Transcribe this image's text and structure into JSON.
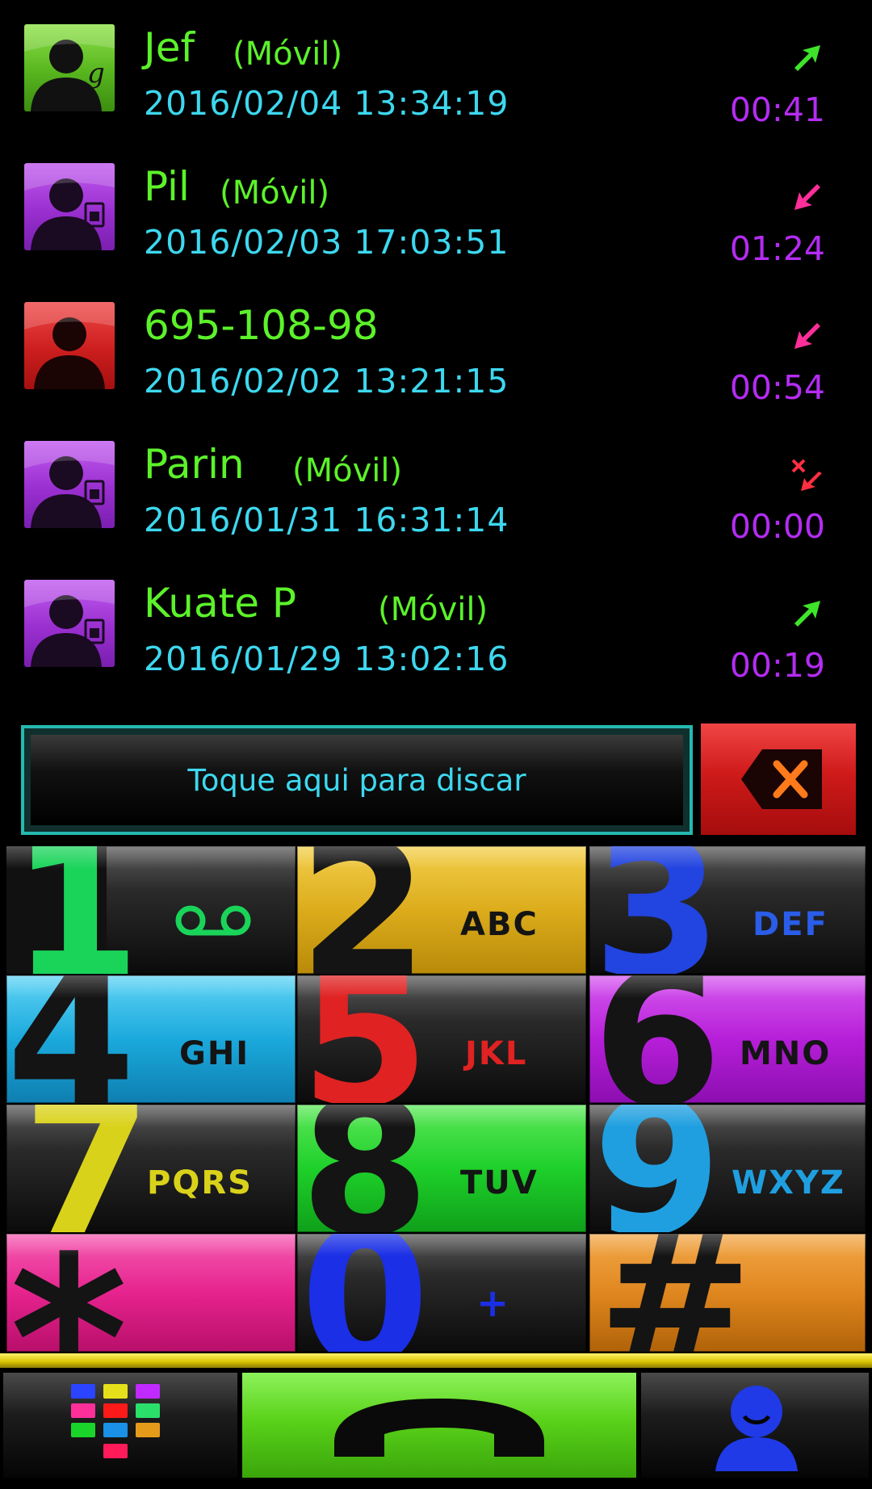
{
  "calls": [
    {
      "name": "Jef",
      "type": "(Móvil)",
      "date": "2016/02/04 13:34:19",
      "duration": "00:41",
      "direction": "outgoing",
      "avatar": "google-contact"
    },
    {
      "name": "Pil",
      "type": "(Móvil)",
      "date": "2016/02/03 17:03:51",
      "duration": "01:24",
      "direction": "incoming",
      "avatar": "sim-contact"
    },
    {
      "name": "695-108-98",
      "type": "",
      "date": "2016/02/02 13:21:15",
      "duration": "00:54",
      "direction": "incoming",
      "avatar": "unknown-contact"
    },
    {
      "name": "Parin",
      "type": "(Móvil)",
      "date": "2016/01/31 16:31:14",
      "duration": "00:00",
      "direction": "missed",
      "avatar": "sim-contact"
    },
    {
      "name": "Kuate P",
      "type": "(Móvil)",
      "date": "2016/01/29 13:02:16",
      "duration": "00:19",
      "direction": "outgoing",
      "avatar": "sim-contact"
    }
  ],
  "dial": {
    "placeholder": "Toque aqui para discar",
    "backspace_icon": "backspace-x-icon"
  },
  "keypad": [
    {
      "digit": "1",
      "letters": "",
      "icon": "voicemail-icon",
      "color": "#1ad45a"
    },
    {
      "digit": "2",
      "letters": "ABC",
      "color": "#e2b52a"
    },
    {
      "digit": "3",
      "letters": "DEF",
      "color": "#2244e0"
    },
    {
      "digit": "4",
      "letters": "GHI",
      "color": "#1ba9dc"
    },
    {
      "digit": "5",
      "letters": "JKL",
      "color": "#e02222"
    },
    {
      "digit": "6",
      "letters": "MNO",
      "color": "#b61fd8"
    },
    {
      "digit": "7",
      "letters": "PQRS",
      "color": "#d9d21a"
    },
    {
      "digit": "8",
      "letters": "TUV",
      "color": "#1ed02a"
    },
    {
      "digit": "9",
      "letters": "WXYZ",
      "color": "#1f9fe0"
    },
    {
      "digit": "*",
      "letters": "",
      "color": "#e6238e"
    },
    {
      "digit": "0",
      "letters": "+",
      "color": "#1a2fe6"
    },
    {
      "digit": "#",
      "letters": "",
      "color": "#e0871f"
    }
  ],
  "bottom_bar": {
    "apps_icon": "app-grid-icon",
    "call_icon": "phone-handset-icon",
    "contacts_icon": "contact-person-icon"
  },
  "colors": {
    "name": "#5cf22a",
    "date": "#3dd8ef",
    "duration": "#b42cf2",
    "outgoing_arrow": "#3ee52a",
    "incoming_arrow": "#ff2f9a",
    "missed": "#ff2f40",
    "dial_border": "#25b8b0",
    "call_button": "#5ad21a",
    "divider": "#e6d400"
  }
}
